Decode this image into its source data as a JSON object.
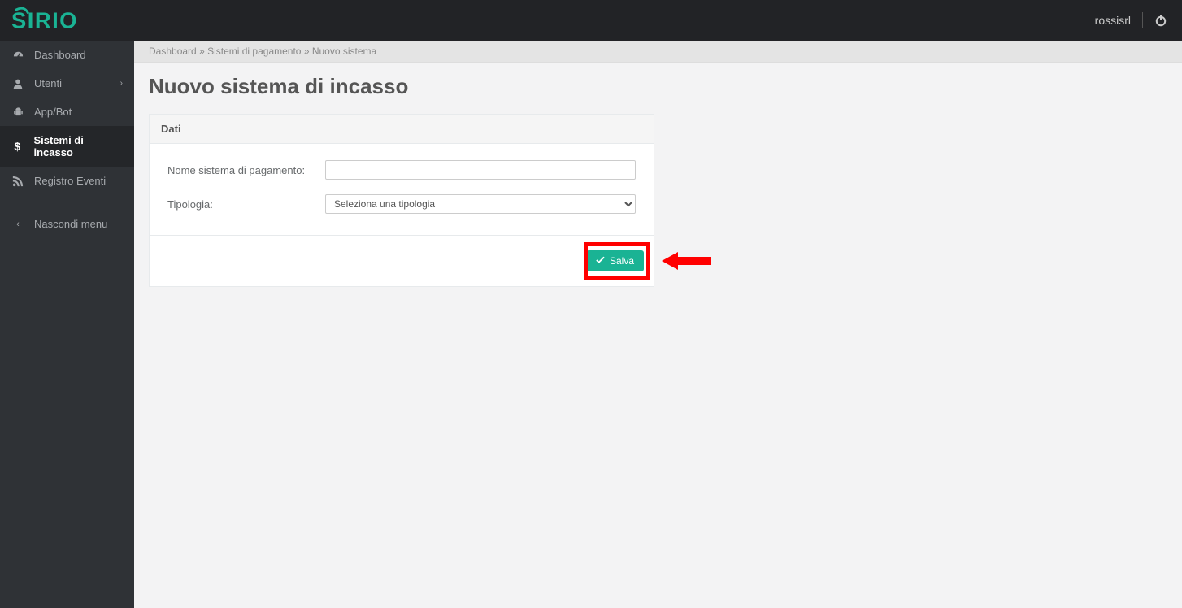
{
  "brand": "SIRIO",
  "user": {
    "name": "rossisrl"
  },
  "sidebar": {
    "items": [
      {
        "label": "Dashboard",
        "icon": "dashboard",
        "active": false,
        "submenu": false
      },
      {
        "label": "Utenti",
        "icon": "user",
        "active": false,
        "submenu": true
      },
      {
        "label": "App/Bot",
        "icon": "android",
        "active": false,
        "submenu": false
      },
      {
        "label": "Sistemi di incasso",
        "icon": "dollar",
        "active": true,
        "submenu": false
      },
      {
        "label": "Registro Eventi",
        "icon": "rss",
        "active": false,
        "submenu": false
      }
    ],
    "collapse_label": "Nascondi menu"
  },
  "breadcrumb": {
    "items": [
      "Dashboard",
      "Sistemi di pagamento",
      "Nuovo sistema"
    ],
    "sep": " » "
  },
  "page": {
    "title": "Nuovo sistema di incasso"
  },
  "panel": {
    "heading": "Dati",
    "fields": {
      "nome": {
        "label": "Nome sistema di pagamento:",
        "value": ""
      },
      "tipologia": {
        "label": "Tipologia:",
        "selected": "Seleziona una tipologia"
      }
    },
    "save_label": "Salva"
  },
  "colors": {
    "accent": "#1ab394",
    "danger": "#ff0000"
  }
}
